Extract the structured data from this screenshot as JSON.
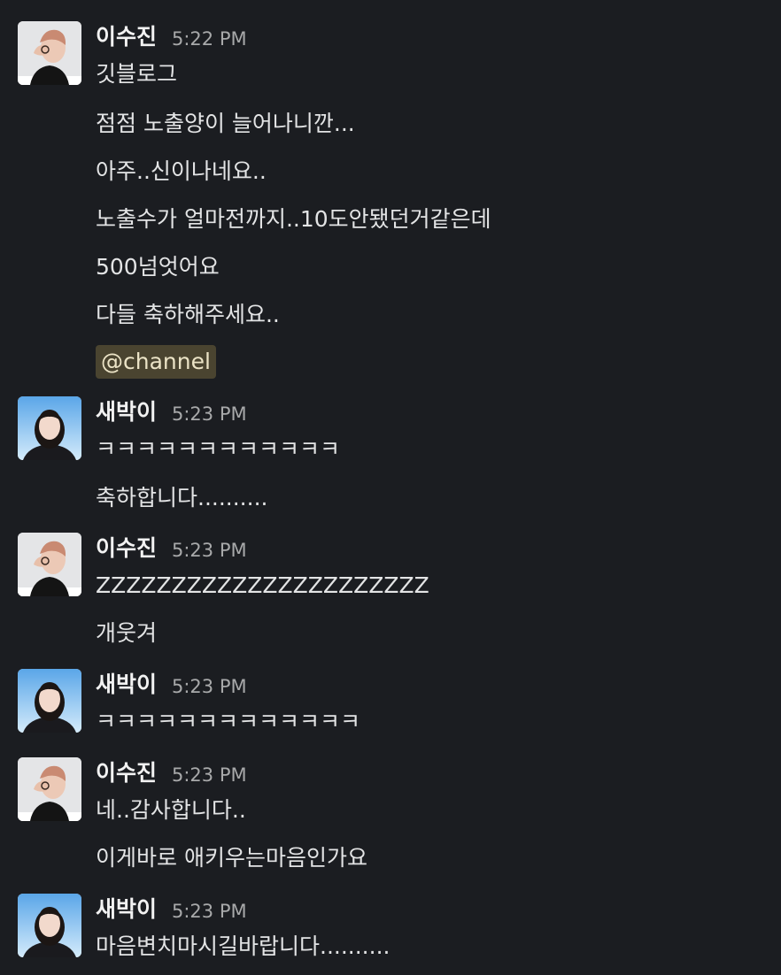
{
  "messages": [
    {
      "author": "이수진",
      "time": "5:22 PM",
      "avatar": "avatar-lee-sujin",
      "lines": [
        "깃블로그",
        "점점 노출양이 늘어나니깐...",
        "아주..신이나네요..",
        "노출수가 얼마전까지..10도안됐던거같은데",
        "500넘엇어요",
        "다들 축하해주세요.."
      ],
      "mention": "@channel"
    },
    {
      "author": "새박이",
      "time": "5:23 PM",
      "avatar": "avatar-saebak",
      "lines": [
        "ㅋㅋㅋㅋㅋㅋㅋㅋㅋㅋㅋㅋ",
        "축하합니다.........."
      ]
    },
    {
      "author": "이수진",
      "time": "5:23 PM",
      "avatar": "avatar-lee-sujin",
      "lines": [
        "ZZZZZZZZZZZZZZZZZZZZZZ",
        "개웃겨"
      ]
    },
    {
      "author": "새박이",
      "time": "5:23 PM",
      "avatar": "avatar-saebak",
      "lines": [
        "ㅋㅋㅋㅋㅋㅋㅋㅋㅋㅋㅋㅋㅋ"
      ]
    },
    {
      "author": "이수진",
      "time": "5:23 PM",
      "avatar": "avatar-lee-sujin",
      "lines": [
        "네..감사합니다..",
        "이게바로 애키우는마음인가요"
      ]
    },
    {
      "author": "새박이",
      "time": "5:23 PM",
      "avatar": "avatar-saebak",
      "lines": [
        "마음변치마시길바랍니다.........."
      ]
    }
  ],
  "colors": {
    "background": "#1b1d21",
    "text": "#e3e4e5",
    "timestamp": "#a8a9aa",
    "mention_bg": "#4a4430",
    "mention_text": "#ebe3c6"
  }
}
